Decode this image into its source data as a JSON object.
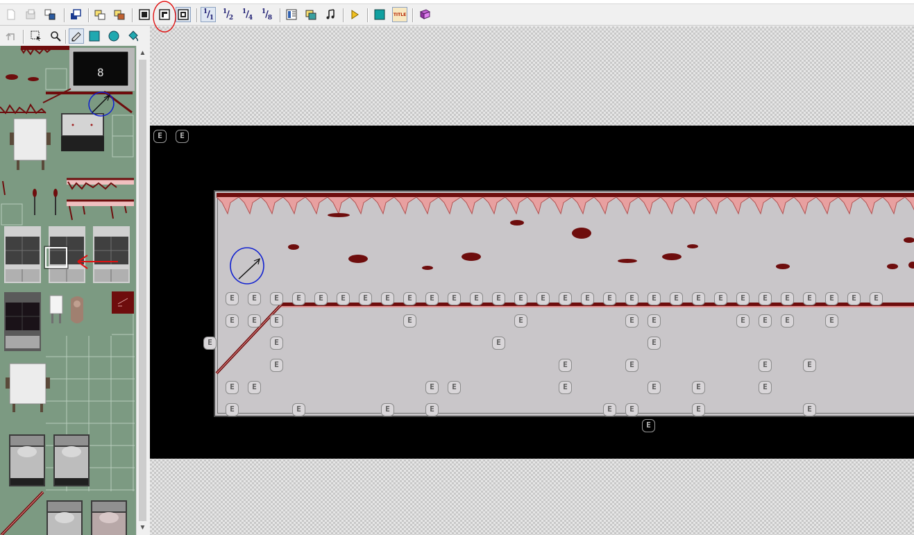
{
  "toolbar": {
    "buttons": [
      {
        "id": "new",
        "icon": "new-project-icon"
      },
      {
        "id": "open",
        "icon": "open-project-icon"
      },
      {
        "id": "close",
        "icon": "close-project-icon"
      },
      {
        "id": "create-game-disk",
        "icon": "create-game-disk-icon"
      },
      {
        "id": "import",
        "icon": "import-material-icon"
      },
      {
        "id": "export",
        "icon": "export-material-icon"
      },
      {
        "id": "layer-lower",
        "icon": "lower-layer-icon"
      },
      {
        "id": "layer-upper",
        "icon": "upper-layer-icon"
      },
      {
        "id": "layer-event",
        "icon": "event-layer-icon"
      },
      {
        "id": "zoom-1-1",
        "label": "1/1"
      },
      {
        "id": "zoom-1-2",
        "label": "1/2"
      },
      {
        "id": "zoom-1-4",
        "label": "1/4"
      },
      {
        "id": "zoom-1-8",
        "label": "1/8"
      },
      {
        "id": "database",
        "icon": "database-icon"
      },
      {
        "id": "material-base",
        "icon": "material-base-icon"
      },
      {
        "id": "music",
        "icon": "music-icon"
      },
      {
        "id": "test-play",
        "icon": "play-icon"
      },
      {
        "id": "fullscreen",
        "icon": "fullscreen-icon"
      },
      {
        "id": "title-screen",
        "label": "TITLE"
      },
      {
        "id": "help",
        "icon": "help-book-icon"
      }
    ]
  },
  "palette_tools": [
    {
      "id": "undo",
      "icon": "undo-icon"
    },
    {
      "id": "select",
      "icon": "select-icon"
    },
    {
      "id": "zoom",
      "icon": "magnifier-icon"
    },
    {
      "id": "pencil",
      "icon": "pencil-icon"
    },
    {
      "id": "rectangle",
      "icon": "rectangle-icon"
    },
    {
      "id": "ellipse",
      "icon": "ellipse-icon"
    },
    {
      "id": "fill",
      "icon": "fill-icon"
    }
  ],
  "event_marker": {
    "label": "E"
  },
  "colors": {
    "palette_bg": "#7c9a82",
    "room_floor": "#c9c6c9",
    "blood": "#6e0d0d",
    "annotation_red": "#e01010",
    "annotation_blue": "#1020d0"
  },
  "state": {
    "active_layer": "event",
    "zoom": "1/1"
  }
}
